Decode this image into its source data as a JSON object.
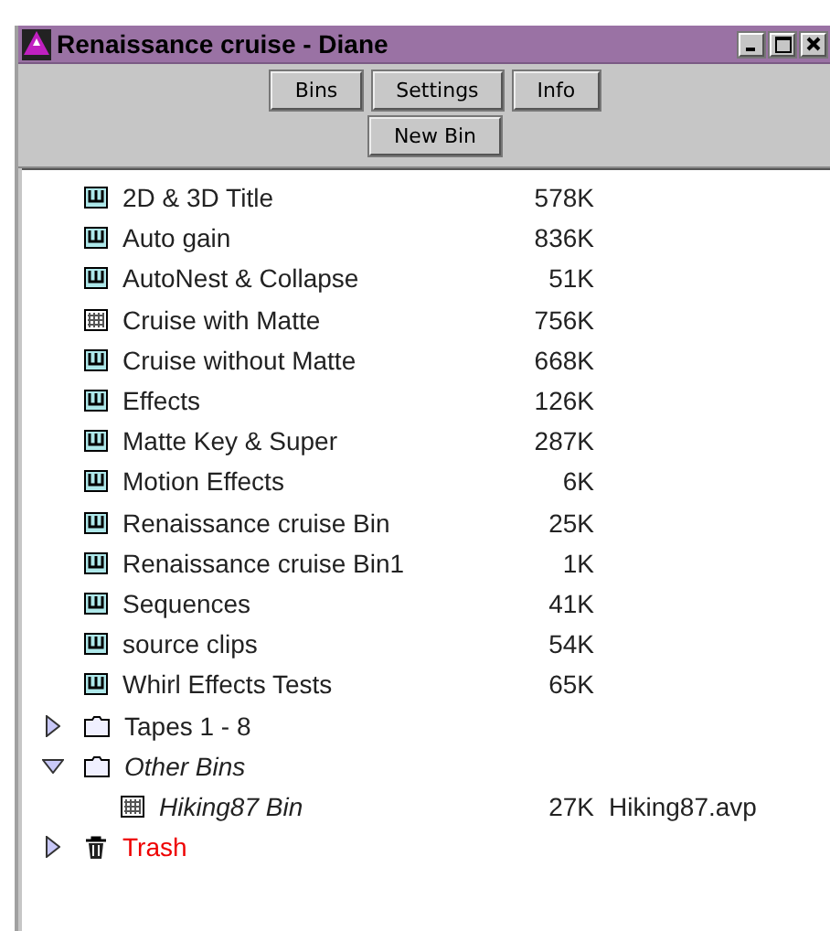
{
  "window": {
    "title": "Renaissance cruise - Diane"
  },
  "buttons": [
    [
      "Bins",
      "Settings",
      "Info"
    ],
    [
      "New Bin"
    ]
  ],
  "items": [
    {
      "kind": "bin",
      "name": "2D & 3D Title",
      "size": "578K"
    },
    {
      "kind": "bin",
      "name": "Auto gain",
      "size": "836K"
    },
    {
      "kind": "bin",
      "name": "AutoNest & Collapse",
      "size": "51K"
    },
    {
      "kind": "grid",
      "name": "Cruise with Matte",
      "size": "756K"
    },
    {
      "kind": "bin",
      "name": "Cruise without Matte",
      "size": "668K"
    },
    {
      "kind": "bin",
      "name": "Effects",
      "size": "126K"
    },
    {
      "kind": "bin",
      "name": "Matte Key & Super",
      "size": "287K"
    },
    {
      "kind": "bin",
      "name": "Motion Effects",
      "size": "6K"
    },
    {
      "kind": "bin",
      "name": "Renaissance cruise Bin",
      "size": "25K"
    },
    {
      "kind": "bin",
      "name": "Renaissance cruise Bin1",
      "size": "1K"
    },
    {
      "kind": "bin",
      "name": "Sequences",
      "size": "41K"
    },
    {
      "kind": "bin",
      "name": "source clips",
      "size": "54K"
    },
    {
      "kind": "bin",
      "name": "Whirl Effects Tests",
      "size": "65K"
    },
    {
      "kind": "folder",
      "name": "Tapes 1 - 8",
      "expanded": false
    },
    {
      "kind": "folder",
      "name": "Other Bins",
      "expanded": true,
      "italic": true,
      "children": [
        {
          "kind": "grid",
          "name": "Hiking87 Bin",
          "size": "27K",
          "file": "Hiking87.avp",
          "italic": true
        }
      ]
    },
    {
      "kind": "trash",
      "name": "Trash",
      "expanded": false
    }
  ]
}
